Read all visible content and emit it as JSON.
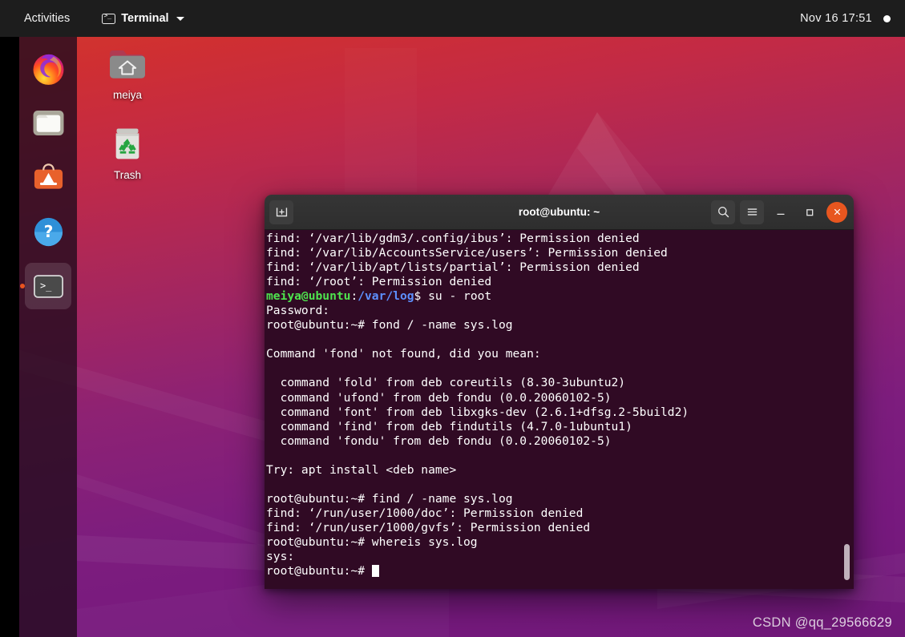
{
  "topbar": {
    "activities": "Activities",
    "app_name": "Terminal",
    "app_icon": "terminal-icon",
    "caret_icon": "chevron-down-icon",
    "clock": "Nov 16  17:51",
    "status_icon": "status-dot-icon"
  },
  "dock": {
    "items": [
      {
        "name": "firefox",
        "label": "Firefox",
        "icon": "firefox-icon",
        "active": false
      },
      {
        "name": "files",
        "label": "Files",
        "icon": "files-folder-icon",
        "active": false
      },
      {
        "name": "ubuntu-software",
        "label": "Ubuntu Software",
        "icon": "ubuntu-software-icon",
        "active": false
      },
      {
        "name": "help",
        "label": "Help",
        "icon": "help-question-icon",
        "active": false
      },
      {
        "name": "terminal",
        "label": "Terminal",
        "icon": "terminal-icon",
        "active": true
      }
    ]
  },
  "desktop": {
    "icons": [
      {
        "name": "home-folder",
        "label": "meiya",
        "icon": "home-folder-icon"
      },
      {
        "name": "trash",
        "label": "Trash",
        "icon": "trash-icon"
      }
    ]
  },
  "terminal": {
    "title": "root@ubuntu: ~",
    "new_tab_icon": "new-tab-icon",
    "search_icon": "search-icon",
    "menu_icon": "hamburger-menu-icon",
    "minimize_icon": "minimize-icon",
    "maximize_icon": "maximize-icon",
    "close_icon": "close-icon",
    "background_color": "#300a24",
    "prompt_user_color": "#4ee44e",
    "prompt_path_color": "#5d90ff",
    "lines": [
      {
        "type": "plain",
        "text": "find: ‘/var/lib/gdm3/.config/ibus’: Permission denied"
      },
      {
        "type": "plain",
        "text": "find: ‘/var/lib/AccountsService/users’: Permission denied"
      },
      {
        "type": "plain",
        "text": "find: ‘/var/lib/apt/lists/partial’: Permission denied"
      },
      {
        "type": "plain",
        "text": "find: ‘/root’: Permission denied"
      },
      {
        "type": "user-prompt",
        "user": "meiya@ubuntu",
        "sep": ":",
        "path": "/var/log",
        "sigil": "$ ",
        "command": "su - root"
      },
      {
        "type": "plain",
        "text": "Password:"
      },
      {
        "type": "root-prompt",
        "prompt": "root@ubuntu:~# ",
        "command": "fond / -name sys.log"
      },
      {
        "type": "plain",
        "text": ""
      },
      {
        "type": "plain",
        "text": "Command 'fond' not found, did you mean:"
      },
      {
        "type": "plain",
        "text": ""
      },
      {
        "type": "plain",
        "text": "  command 'fold' from deb coreutils (8.30-3ubuntu2)"
      },
      {
        "type": "plain",
        "text": "  command 'ufond' from deb fondu (0.0.20060102-5)"
      },
      {
        "type": "plain",
        "text": "  command 'font' from deb libxgks-dev (2.6.1+dfsg.2-5build2)"
      },
      {
        "type": "plain",
        "text": "  command 'find' from deb findutils (4.7.0-1ubuntu1)"
      },
      {
        "type": "plain",
        "text": "  command 'fondu' from deb fondu (0.0.20060102-5)"
      },
      {
        "type": "plain",
        "text": ""
      },
      {
        "type": "plain",
        "text": "Try: apt install <deb name>"
      },
      {
        "type": "plain",
        "text": ""
      },
      {
        "type": "root-prompt",
        "prompt": "root@ubuntu:~# ",
        "command": "find / -name sys.log"
      },
      {
        "type": "plain",
        "text": "find: ‘/run/user/1000/doc’: Permission denied"
      },
      {
        "type": "plain",
        "text": "find: ‘/run/user/1000/gvfs’: Permission denied"
      },
      {
        "type": "root-prompt",
        "prompt": "root@ubuntu:~# ",
        "command": "whereis sys.log"
      },
      {
        "type": "plain",
        "text": "sys:"
      },
      {
        "type": "cursor-prompt",
        "prompt": "root@ubuntu:~# "
      }
    ]
  },
  "watermark": "CSDN @qq_29566629"
}
